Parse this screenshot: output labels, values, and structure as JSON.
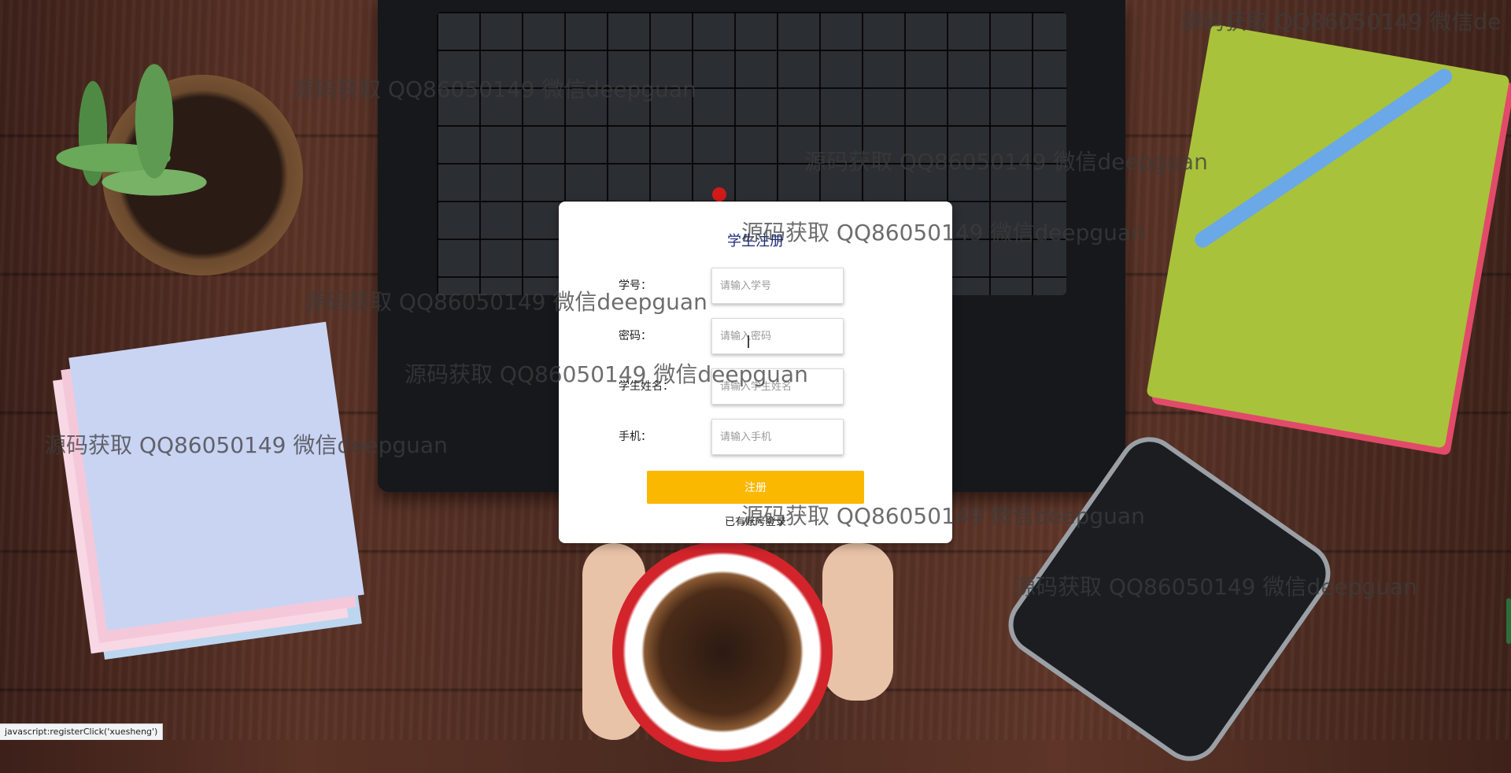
{
  "dialog": {
    "title": "学生注册",
    "fields": [
      {
        "label": "学号：",
        "placeholder": "请输入学号",
        "value": ""
      },
      {
        "label": "密码：",
        "placeholder": "请输入密码",
        "value": ""
      },
      {
        "label": "学生姓名：",
        "placeholder": "请输入学生姓名",
        "value": ""
      },
      {
        "label": "手机：",
        "placeholder": "请输入手机",
        "value": ""
      }
    ],
    "submit_label": "注册",
    "login_link": "已有账号登录",
    "accent_color": "#fbb800",
    "title_color": "#1a2b7a"
  },
  "watermarks": [
    "源码获取 QQ86050149 微信deepguan",
    "源码获取 QQ86050149 微信deepguan",
    "源码获取 QQ86050149 微信deepguan",
    "源码获取 QQ86050149 微信deepguan",
    "源码获取 QQ86050149 微信deepguan",
    "源码获取 QQ86050149 微信deepguan",
    "源码获取 QQ86050149 微信deepguan",
    "源码获取 QQ86050149 微信deepguan",
    "源码获取 QQ86050149 微信de"
  ],
  "status_bar": "javascript:registerClick('xuesheng')"
}
